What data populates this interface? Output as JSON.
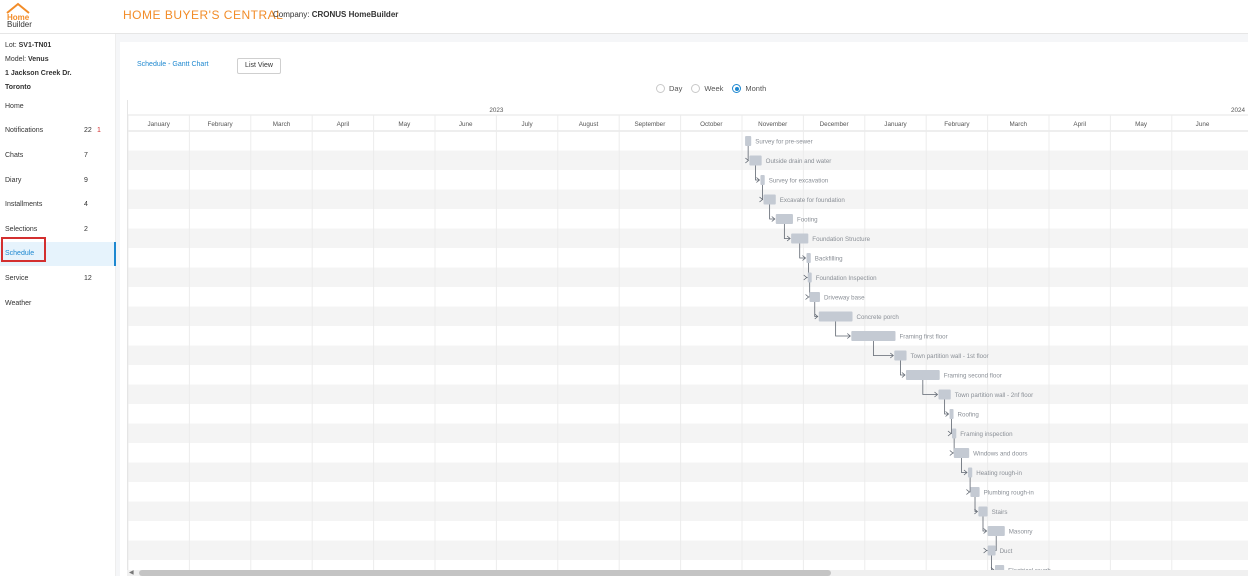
{
  "header": {
    "logo_line1": "Home",
    "logo_line2": "Builder",
    "title": "HOME BUYER'S CENTRAL",
    "company_label": "Company:",
    "company_name": "CRONUS HomeBuilder",
    "brand_color": "#f28c28"
  },
  "lot": {
    "lot_label": "Lot:",
    "lot_value": "SV1-TN01",
    "model_label": "Model:",
    "model_value": "Venus",
    "address_line1": "1 Jackson Creek Dr.",
    "address_line2": "Toronto"
  },
  "sidebar": {
    "items": [
      {
        "label": "Home",
        "count": "",
        "alert": ""
      },
      {
        "label": "Notifications",
        "count": "22",
        "alert": "1"
      },
      {
        "label": "Chats",
        "count": "7",
        "alert": ""
      },
      {
        "label": "Diary",
        "count": "9",
        "alert": ""
      },
      {
        "label": "Installments",
        "count": "4",
        "alert": ""
      },
      {
        "label": "Selections",
        "count": "2",
        "alert": ""
      },
      {
        "label": "Schedule",
        "count": "",
        "alert": ""
      },
      {
        "label": "Service",
        "count": "12",
        "alert": ""
      },
      {
        "label": "Weather",
        "count": "",
        "alert": ""
      }
    ],
    "active_item": "Schedule"
  },
  "toolbar": {
    "gantt_tab": "Schedule - Gantt Chart",
    "list_view_button": "List View"
  },
  "view_modes": {
    "options": [
      "Day",
      "Week",
      "Month"
    ],
    "selected": "Month"
  },
  "gantt": {
    "years": [
      "2023",
      "2024"
    ],
    "months": [
      "January",
      "February",
      "March",
      "April",
      "May",
      "June",
      "July",
      "August",
      "September",
      "October",
      "November",
      "December",
      "January",
      "February",
      "March",
      "April",
      "May",
      "June"
    ],
    "tasks": [
      {
        "name": "Survey for pre-sewer",
        "start": 10.05,
        "duration": 0.1
      },
      {
        "name": "Outside drain and water",
        "start": 10.12,
        "duration": 0.2
      },
      {
        "name": "Survey for excavation",
        "start": 10.3,
        "duration": 0.07
      },
      {
        "name": "Excavate for foundation",
        "start": 10.35,
        "duration": 0.2
      },
      {
        "name": "Footing",
        "start": 10.55,
        "duration": 0.28
      },
      {
        "name": "Foundation Structure",
        "start": 10.8,
        "duration": 0.28
      },
      {
        "name": "Backfilling",
        "start": 11.05,
        "duration": 0.07
      },
      {
        "name": "Foundation Inspection",
        "start": 11.07,
        "duration": 0.05
      },
      {
        "name": "Driveway base",
        "start": 11.1,
        "duration": 0.17
      },
      {
        "name": "Concrete porch",
        "start": 11.25,
        "duration": 0.55
      },
      {
        "name": "Framing first floor",
        "start": 11.78,
        "duration": 0.72
      },
      {
        "name": "Town partition wall - 1st floor",
        "start": 12.48,
        "duration": 0.2
      },
      {
        "name": "Framing second floor",
        "start": 12.67,
        "duration": 0.55
      },
      {
        "name": "Town partition wall - 2nf floor",
        "start": 13.2,
        "duration": 0.2
      },
      {
        "name": "Roofing",
        "start": 13.38,
        "duration": 0.06
      },
      {
        "name": "Framing inspection",
        "start": 13.42,
        "duration": 0.07
      },
      {
        "name": "Windows and doors",
        "start": 13.45,
        "duration": 0.25
      },
      {
        "name": "Heating rough-in",
        "start": 13.68,
        "duration": 0.07
      },
      {
        "name": "Plumbing rough-in",
        "start": 13.72,
        "duration": 0.15
      },
      {
        "name": "Stairs",
        "start": 13.85,
        "duration": 0.15
      },
      {
        "name": "Masonry",
        "start": 14.0,
        "duration": 0.28
      },
      {
        "name": "Duct",
        "start": 14.0,
        "duration": 0.13
      },
      {
        "name": "Electrical rough",
        "start": 14.12,
        "duration": 0.15
      }
    ],
    "bar_color": "#c4cad3",
    "stripe_color": "#f4f4f4"
  }
}
